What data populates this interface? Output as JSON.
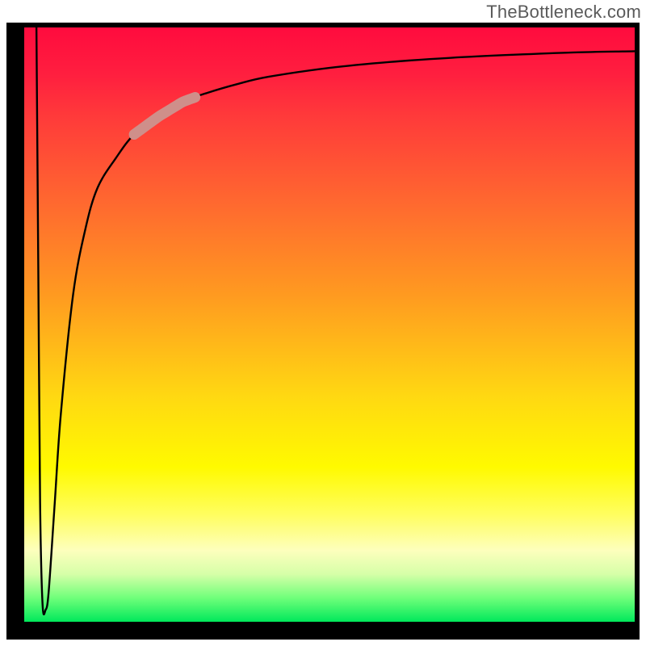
{
  "watermark": "TheBottleneck.com",
  "chart_data": {
    "type": "line",
    "title": "",
    "xlabel": "",
    "ylabel": "",
    "xlim": [
      0,
      100
    ],
    "ylim": [
      0,
      100
    ],
    "series": [
      {
        "name": "curve",
        "x": [
          2,
          2.3,
          2.6,
          3,
          3.5,
          4,
          5,
          6,
          8,
          10,
          12,
          15,
          18,
          22,
          26,
          30,
          35,
          40,
          50,
          60,
          70,
          80,
          90,
          100
        ],
        "y": [
          100,
          60,
          20,
          3,
          2,
          5,
          20,
          35,
          55,
          66,
          73,
          78,
          82,
          85,
          87.5,
          89,
          90.5,
          91.7,
          93.2,
          94.2,
          94.9,
          95.4,
          95.8,
          96
        ]
      }
    ],
    "highlight_segment": {
      "x_from": 18,
      "x_to": 28
    },
    "gradient_stops": [
      {
        "pos": 0.0,
        "color": "#ff0b3e"
      },
      {
        "pos": 0.3,
        "color": "#ff6a2f"
      },
      {
        "pos": 0.62,
        "color": "#ffd812"
      },
      {
        "pos": 0.82,
        "color": "#fffe60"
      },
      {
        "pos": 0.92,
        "color": "#d6ffa8"
      },
      {
        "pos": 1.0,
        "color": "#01e85b"
      }
    ]
  }
}
